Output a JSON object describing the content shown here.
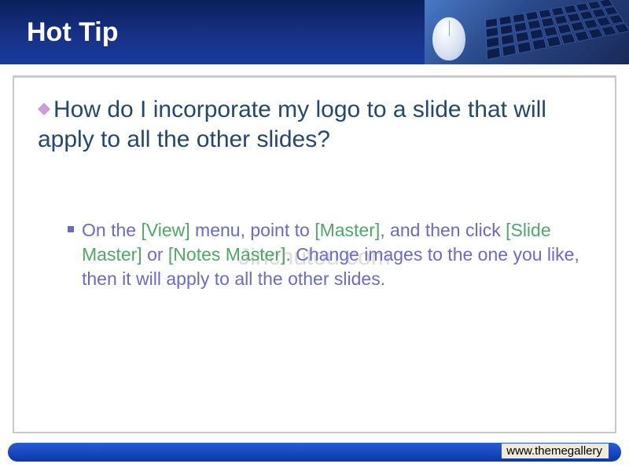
{
  "header": {
    "title": "Hot Tip"
  },
  "content": {
    "question": "How do I incorporate my logo to a slide that will apply to all the other slides?",
    "watermark": "Jinchutou.com",
    "instruction": {
      "t1": "On the ",
      "v": "[View]",
      "t2": " menu, point to ",
      "m": "[Master]",
      "t3": ", and then click ",
      "sm": "[Slide Master]",
      "t4": " or ",
      "nm": "[Notes Master]",
      "t5": ". Change images to the one you like, then it will apply to all the other slides."
    }
  },
  "footer": {
    "link": "www.themegallery"
  }
}
